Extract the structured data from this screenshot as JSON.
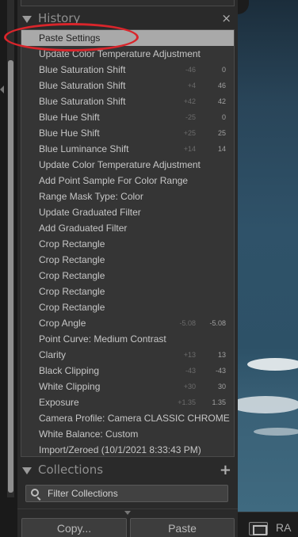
{
  "history": {
    "title": "History",
    "close_glyph": "×",
    "items": [
      {
        "label": "Paste Settings",
        "delta": "",
        "value": "",
        "selected": true
      },
      {
        "label": "Update Color Temperature Adjustment",
        "delta": "",
        "value": ""
      },
      {
        "label": "Blue Saturation Shift",
        "delta": "-46",
        "value": "0"
      },
      {
        "label": "Blue Saturation Shift",
        "delta": "+4",
        "value": "46"
      },
      {
        "label": "Blue Saturation Shift",
        "delta": "+42",
        "value": "42"
      },
      {
        "label": "Blue Hue Shift",
        "delta": "-25",
        "value": "0"
      },
      {
        "label": "Blue Hue Shift",
        "delta": "+25",
        "value": "25"
      },
      {
        "label": "Blue Luminance Shift",
        "delta": "+14",
        "value": "14"
      },
      {
        "label": "Update Color Temperature Adjustment",
        "delta": "",
        "value": ""
      },
      {
        "label": "Add Point Sample For Color Range",
        "delta": "",
        "value": ""
      },
      {
        "label": "Range Mask Type: Color",
        "delta": "",
        "value": ""
      },
      {
        "label": "Update Graduated Filter",
        "delta": "",
        "value": ""
      },
      {
        "label": "Add Graduated Filter",
        "delta": "",
        "value": ""
      },
      {
        "label": "Crop Rectangle",
        "delta": "",
        "value": ""
      },
      {
        "label": "Crop Rectangle",
        "delta": "",
        "value": ""
      },
      {
        "label": "Crop Rectangle",
        "delta": "",
        "value": ""
      },
      {
        "label": "Crop Rectangle",
        "delta": "",
        "value": ""
      },
      {
        "label": "Crop Rectangle",
        "delta": "",
        "value": ""
      },
      {
        "label": "Crop Angle",
        "delta": "-5.08",
        "value": "-5.08"
      },
      {
        "label": "Point Curve: Medium Contrast",
        "delta": "",
        "value": ""
      },
      {
        "label": "Clarity",
        "delta": "+13",
        "value": "13"
      },
      {
        "label": "Black Clipping",
        "delta": "-43",
        "value": "-43"
      },
      {
        "label": "White Clipping",
        "delta": "+30",
        "value": "30"
      },
      {
        "label": "Exposure",
        "delta": "+1.35",
        "value": "1.35"
      },
      {
        "label": "Camera Profile: Camera CLASSIC CHROME",
        "delta": "",
        "value": ""
      },
      {
        "label": "White Balance: Custom",
        "delta": "",
        "value": ""
      },
      {
        "label": "Import/Zeroed (10/1/2021 8:33:43 PM)",
        "delta": "",
        "value": ""
      }
    ]
  },
  "collections": {
    "title": "Collections",
    "add_glyph": "+",
    "filter_label": "Filter Collections"
  },
  "buttons": {
    "copy_label": "Copy...",
    "paste_label": "Paste"
  },
  "toolbar": {
    "view_partial_text": "RA"
  },
  "annotation": {
    "highlight_color": "#d9252b"
  },
  "icons": [
    "collapse-triangle-icon",
    "close-icon",
    "add-icon",
    "search-icon",
    "loupe-view-icon",
    "dropdown-triangle-icon"
  ]
}
